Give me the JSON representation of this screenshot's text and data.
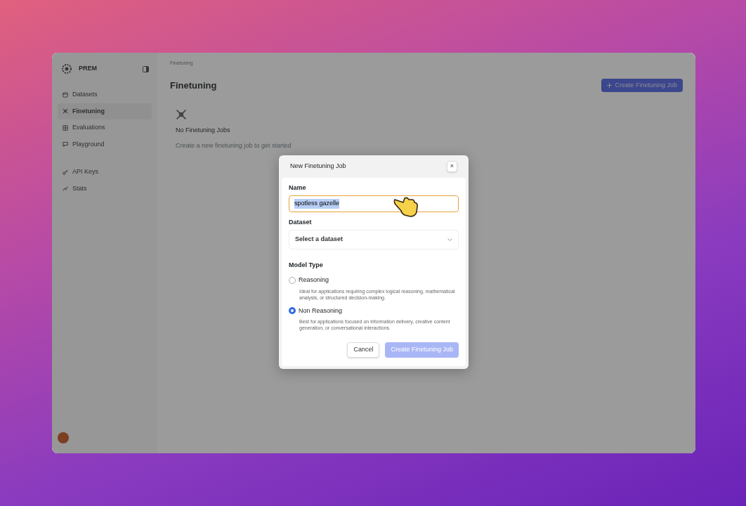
{
  "app": {
    "logo_text": "PREM",
    "sidebar": {
      "items": [
        {
          "label": "Datasets",
          "selected": false
        },
        {
          "label": "Finetuning",
          "selected": true
        },
        {
          "label": "Evaluations",
          "selected": false
        },
        {
          "label": "Playground",
          "selected": false
        },
        {
          "label": "API Keys",
          "selected": false
        },
        {
          "label": "Stats",
          "selected": false
        }
      ]
    },
    "breadcrumb": "Finetuning",
    "page_title": "Finetuning",
    "header_button": "Create Finetuning Job",
    "empty_state": {
      "title": "No Finetuning Jobs",
      "subtitle": "Create a new finetuning job to get started"
    }
  },
  "dialog": {
    "title": "New Finetuning Job",
    "close": "×",
    "name_field": {
      "label": "Name",
      "value": "spotless gazelle",
      "text_selected": true,
      "focused": true
    },
    "dataset_field": {
      "label": "Dataset",
      "placeholder": "Select a dataset"
    },
    "model_type": {
      "label": "Model Type",
      "options": [
        {
          "label": "Reasoning",
          "description": "Ideal for applications requiring complex logical reasoning, mathematical analysis, or structured decision-making.",
          "selected": false
        },
        {
          "label": "Non Reasoning",
          "description": "Best for applications focused on information delivery, creative content generation, or conversational interactions.",
          "selected": true
        }
      ]
    },
    "buttons": [
      {
        "label": "Cancel",
        "kind": "secondary"
      },
      {
        "label": "Create Finetuning Job",
        "kind": "primary",
        "disabled": true
      }
    ]
  }
}
